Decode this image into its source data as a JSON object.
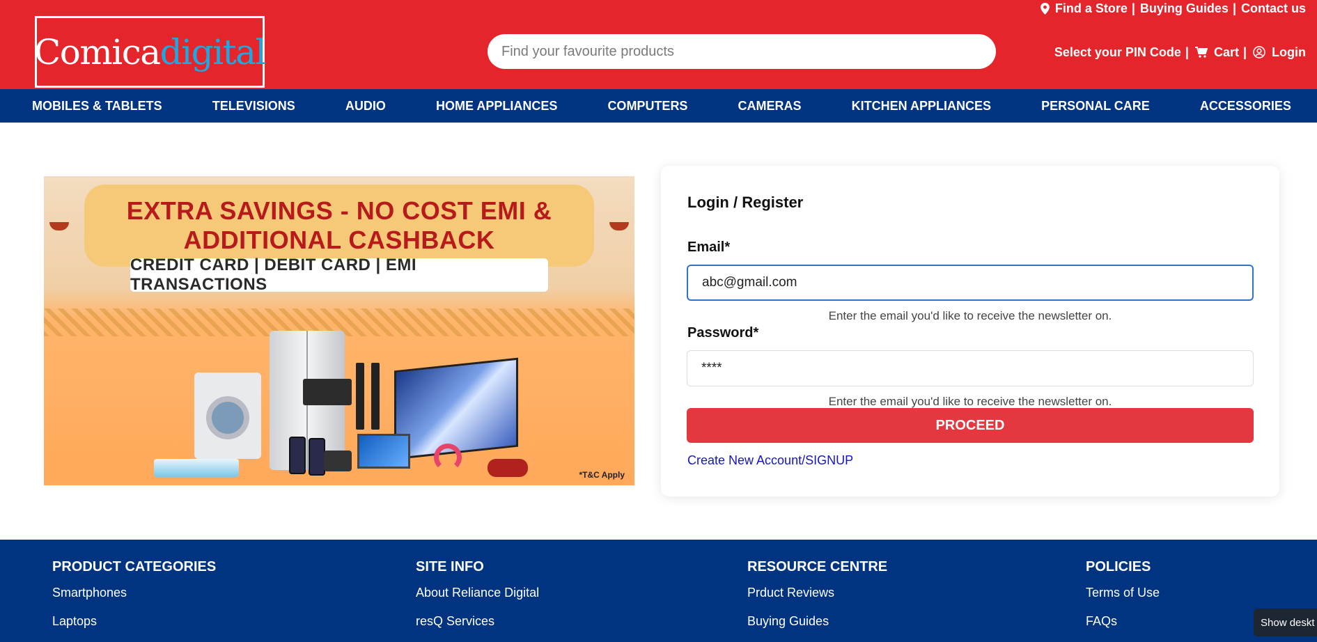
{
  "brand": {
    "logo_part1": "Comica",
    "logo_part2": "digital",
    "primary_color": "#e4252b",
    "logo_accent_color": "#1fa8e0",
    "nav_color": "#003380"
  },
  "top_links": [
    {
      "label": "Find a Store",
      "icon": "map-marker-icon"
    },
    {
      "label": "Buying Guides"
    },
    {
      "label": "Contact us"
    }
  ],
  "search": {
    "placeholder": "Find your favourite products"
  },
  "user_links": {
    "pin": "Select your PIN Code",
    "cart": "Cart",
    "login": "Login"
  },
  "nav": [
    "MOBILES & TABLETS",
    "TELEVISIONS",
    "AUDIO",
    "HOME APPLIANCES",
    "COMPUTERS",
    "CAMERAS",
    "KITCHEN APPLIANCES",
    "PERSONAL CARE",
    "ACCESSORIES"
  ],
  "banner": {
    "line1": "EXTRA SAVINGS - NO COST EMI &",
    "line2": "ADDITIONAL CASHBACK",
    "pill": "CREDIT CARD | DEBIT CARD | EMI TRANSACTIONS",
    "tc": "*T&C Apply"
  },
  "login": {
    "title": "Login / Register",
    "email_label": "Email*",
    "email_value": "abc@gmail.com",
    "email_help": "Enter the email you'd like to receive the newsletter on.",
    "password_label": "Password*",
    "password_value": "****",
    "password_help": "Enter the email you'd like to receive the newsletter on.",
    "proceed_label": "PROCEED",
    "signup_label": "Create New Account/SIGNUP"
  },
  "footer": [
    {
      "heading": "PRODUCT CATEGORIES",
      "links": [
        "Smartphones",
        "Laptops"
      ]
    },
    {
      "heading": "SITE INFO",
      "links": [
        "About Reliance Digital",
        "resQ Services"
      ]
    },
    {
      "heading": "RESOURCE CENTRE",
      "links": [
        "Prduct Reviews",
        "Buying Guides"
      ]
    },
    {
      "heading": "POLICIES",
      "links": [
        "Terms of Use",
        "FAQs"
      ]
    }
  ],
  "desktop_button": "Show deskt"
}
